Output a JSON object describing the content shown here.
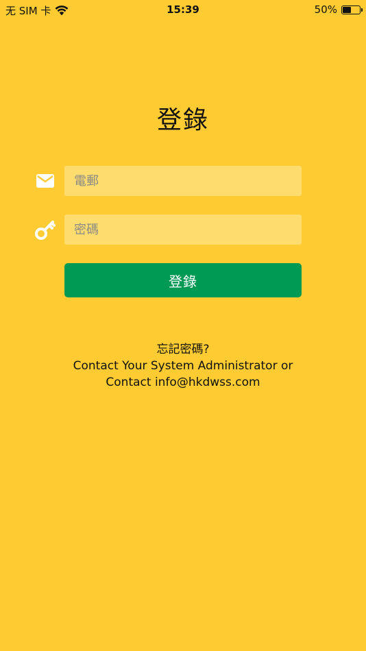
{
  "status_bar": {
    "carrier": "无 SIM 卡",
    "time": "15:39",
    "battery_percent_label": "50%",
    "battery_level": 0.5
  },
  "login": {
    "title": "登錄",
    "email_placeholder": "電郵",
    "password_placeholder": "密碼",
    "submit_label": "登錄"
  },
  "help": {
    "forgot_password": "忘記密碼?",
    "contact_admin": "Contact Your System Administrator or",
    "contact_email": "Contact info@hkdwss.com"
  },
  "icons": {
    "wifi": "wifi-icon",
    "battery": "battery-icon",
    "email": "envelope-icon",
    "password": "key-icon"
  },
  "colors": {
    "background": "#FECC32",
    "input_background": "#FEDC6E",
    "button": "#009A54",
    "button_text": "#FFFFFF",
    "icon": "#FFFFFF"
  }
}
